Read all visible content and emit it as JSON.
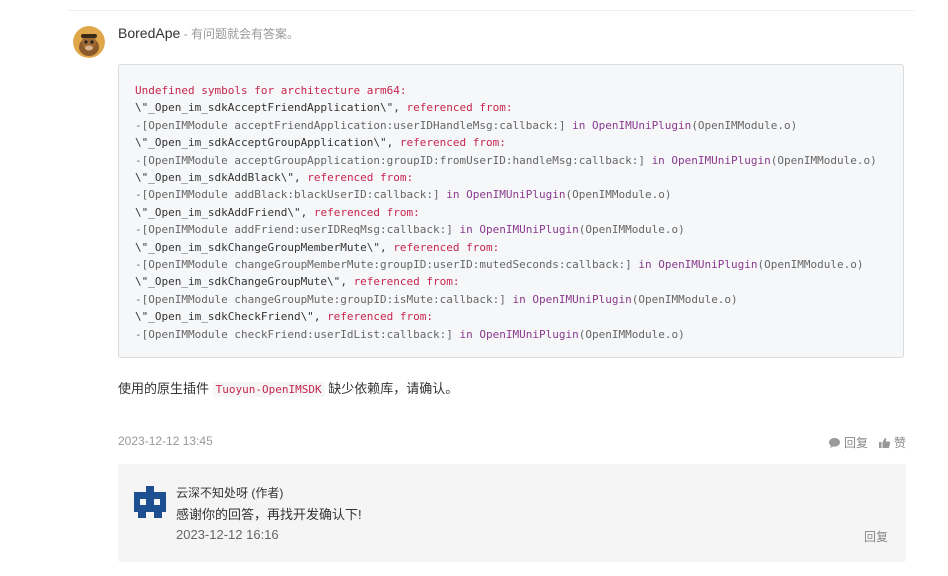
{
  "answer": {
    "author": "BoredApe",
    "separator": " - ",
    "signature": "有问题就会有答案。",
    "code_lines": [
      [
        {
          "t": "Undefined symbols for architecture arm64:",
          "c": "kw"
        }
      ],
      [
        {
          "t": "\\\"_Open_im_sdkAcceptFriendApplication\\\"",
          "c": "str"
        },
        {
          "t": ", ",
          "c": "str"
        },
        {
          "t": "referenced from:",
          "c": "kw"
        }
      ],
      [
        {
          "t": "-[OpenIMModule acceptFriendApplication:userIDHandleMsg:callback:] ",
          "c": ""
        },
        {
          "t": "in OpenIMUniPlugin",
          "c": "purple"
        },
        {
          "t": "(OpenIMModule.o)",
          "c": ""
        }
      ],
      [
        {
          "t": "\\\"_Open_im_sdkAcceptGroupApplication\\\"",
          "c": "str"
        },
        {
          "t": ", ",
          "c": "str"
        },
        {
          "t": "referenced from:",
          "c": "kw"
        }
      ],
      [
        {
          "t": "-[OpenIMModule acceptGroupApplication:groupID:fromUserID:handleMsg:callback:] ",
          "c": ""
        },
        {
          "t": "in OpenIMUniPlugin",
          "c": "purple"
        },
        {
          "t": "(OpenIMModule.o)",
          "c": ""
        }
      ],
      [
        {
          "t": "\\\"_Open_im_sdkAddBlack\\\"",
          "c": "str"
        },
        {
          "t": ", ",
          "c": "str"
        },
        {
          "t": "referenced from:",
          "c": "kw"
        }
      ],
      [
        {
          "t": "-[OpenIMModule addBlack:blackUserID:callback:] ",
          "c": ""
        },
        {
          "t": "in OpenIMUniPlugin",
          "c": "purple"
        },
        {
          "t": "(OpenIMModule.o)",
          "c": ""
        }
      ],
      [
        {
          "t": "\\\"_Open_im_sdkAddFriend\\\"",
          "c": "str"
        },
        {
          "t": ", ",
          "c": "str"
        },
        {
          "t": "referenced from:",
          "c": "kw"
        }
      ],
      [
        {
          "t": "-[OpenIMModule addFriend:userIDReqMsg:callback:] ",
          "c": ""
        },
        {
          "t": "in OpenIMUniPlugin",
          "c": "purple"
        },
        {
          "t": "(OpenIMModule.o)",
          "c": ""
        }
      ],
      [
        {
          "t": "\\\"_Open_im_sdkChangeGroupMemberMute\\\"",
          "c": "str"
        },
        {
          "t": ", ",
          "c": "str"
        },
        {
          "t": "referenced from:",
          "c": "kw"
        }
      ],
      [
        {
          "t": "-[OpenIMModule changeGroupMemberMute:groupID:userID:mutedSeconds:callback:] ",
          "c": ""
        },
        {
          "t": "in OpenIMUniPlugin",
          "c": "purple"
        },
        {
          "t": "(OpenIMModule.o)",
          "c": ""
        }
      ],
      [
        {
          "t": "\\\"_Open_im_sdkChangeGroupMute\\\"",
          "c": "str"
        },
        {
          "t": ", ",
          "c": "str"
        },
        {
          "t": "referenced from:",
          "c": "kw"
        }
      ],
      [
        {
          "t": "-[OpenIMModule changeGroupMute:groupID:isMute:callback:] ",
          "c": ""
        },
        {
          "t": "in OpenIMUniPlugin",
          "c": "purple"
        },
        {
          "t": "(OpenIMModule.o)",
          "c": ""
        }
      ],
      [
        {
          "t": "\\\"_Open_im_sdkCheckFriend\\\"",
          "c": "str"
        },
        {
          "t": ", ",
          "c": "str"
        },
        {
          "t": "referenced from:",
          "c": "kw"
        }
      ],
      [
        {
          "t": "-[OpenIMModule checkFriend:userIdList:callback:] ",
          "c": ""
        },
        {
          "t": "in OpenIMUniPlugin",
          "c": "purple"
        },
        {
          "t": "(OpenIMModule.o)",
          "c": ""
        }
      ]
    ],
    "body_prefix": "使用的原生插件 ",
    "body_code": "Tuoyun-OpenIMSDK",
    "body_suffix": " 缺少依赖库，请确认。",
    "timestamp": "2023-12-12 13:45",
    "reply_label": "回复",
    "like_label": "赞"
  },
  "comment": {
    "author": "云深不知处呀 (作者)",
    "text": "感谢你的回答，再找开发确认下!",
    "timestamp": "2023-12-12 16:16",
    "reply_label": "回复"
  },
  "icons": {
    "avatar": "bored-ape-avatar",
    "comment_avatar": "blue-block-avatar",
    "reply": "speech-bubble-icon",
    "like": "thumbs-up-icon"
  },
  "colors": {
    "keyword": "#c7254e",
    "plugin": "#8a3a8f",
    "comment_avatar": "#1d4f91"
  }
}
